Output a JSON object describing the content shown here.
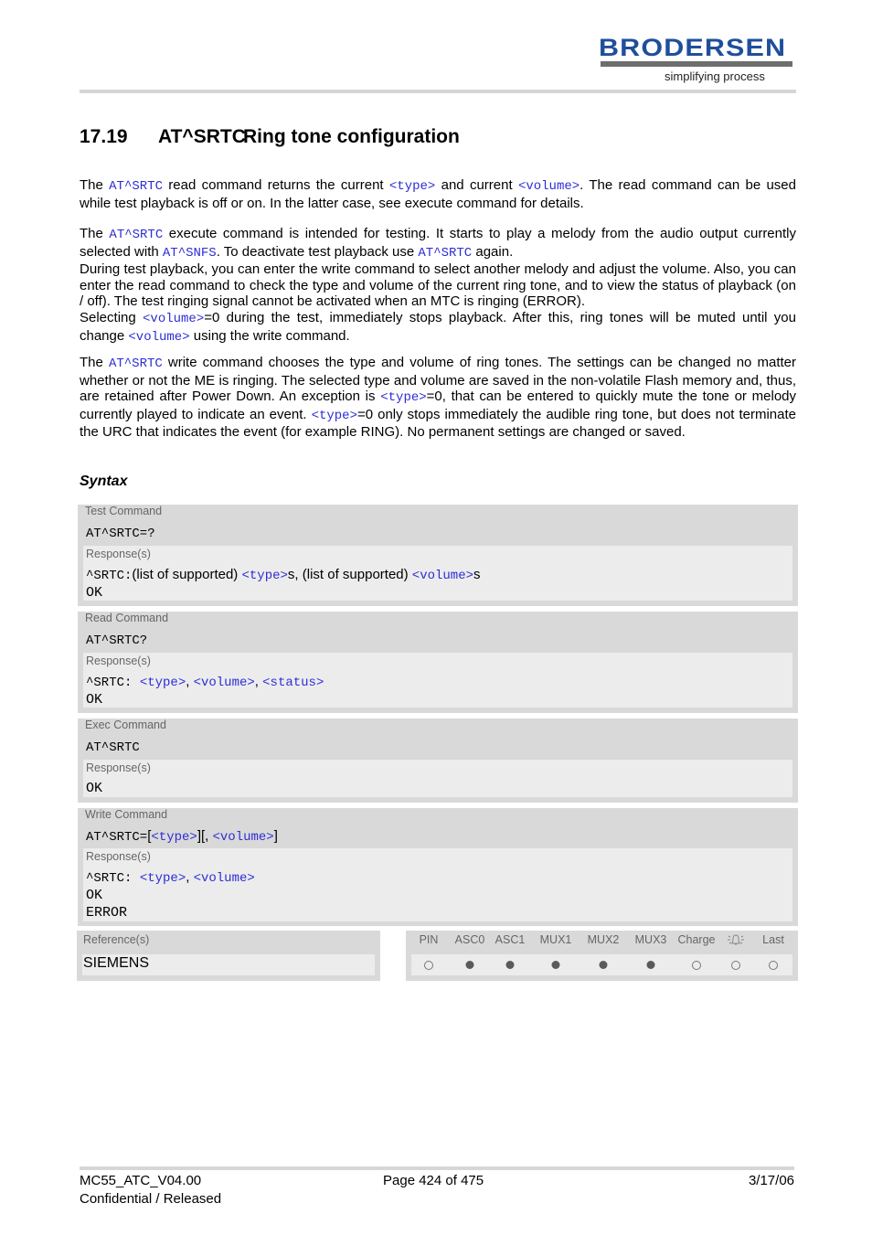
{
  "header": {
    "logo_text": "BRODERSEN",
    "logo_tagline": "simplifying process",
    "brand_color": "#1f4f9c"
  },
  "section": {
    "number": "17.19",
    "command": "AT^SRTC",
    "title": "Ring tone configuration"
  },
  "paragraphs": {
    "p1": {
      "t1": "The ",
      "c1": "AT^SRTC",
      "t2": " read command returns the current ",
      "c2": "<type>",
      "t3": " and current ",
      "c3": "<volume>",
      "t4": ". The read command can be used while test playback is off or on. In the latter case, see execute command for details."
    },
    "p2": {
      "t1": "The ",
      "c1": "AT^SRTC",
      "t2": " execute command is intended for testing. It starts to play a melody from the audio output currently selected with ",
      "c2": "AT^SNFS",
      "t3": ". To deactivate test playback use ",
      "c3": "AT^SRTC",
      "t4": " again."
    },
    "p3": "During test playback, you can enter the write command to select another melody and adjust the volume. Also, you can enter the read command to check the type and volume of the current ring tone, and to view the status of playback (on / off). The test ringing signal cannot be activated when an MTC is ringing (ERROR).",
    "p4": {
      "t1": "Selecting ",
      "c1": "<volume>",
      "t2": "=0 during the test, immediately stops playback. After this, ring tones will be muted until you change ",
      "c2": "<volume>",
      "t3": " using the write command."
    },
    "p5": {
      "t1": "The ",
      "c1": "AT^SRTC",
      "t2": " write command chooses the type and volume of ring tones. The settings can be changed no matter whether or not the ME is ringing. The selected type and volume are saved in the non-volatile Flash memory and, thus, are retained after Power Down. An exception is ",
      "c2": "<type>",
      "t3": "=0, that can be entered to quickly mute the tone or melody currently played to indicate an event. ",
      "c3": "<type>",
      "t4": "=0 only stops immediately the audible ring tone, but does not terminate the URC that indicates the event (for example RING). No permanent settings are changed or saved."
    }
  },
  "syntax": {
    "heading": "Syntax",
    "response_label": "Response(s)",
    "test": {
      "label": "Test Command",
      "command": "AT^SRTC=?",
      "resp_prefix": "^SRTC:",
      "resp_t1": "(list of supported) ",
      "resp_c1": "<type>",
      "resp_t2": "s, (list of supported) ",
      "resp_c2": "<volume>",
      "resp_t3": "s",
      "ok": "OK"
    },
    "read": {
      "label": "Read Command",
      "command": "AT^SRTC?",
      "resp_prefix": "^SRTC: ",
      "resp_c1": "<type>",
      "sep1": ", ",
      "resp_c2": "<volume>",
      "sep2": ", ",
      "resp_c3": "<status>",
      "ok": "OK"
    },
    "exec": {
      "label": "Exec Command",
      "command": "AT^SRTC",
      "ok": "OK"
    },
    "write": {
      "label": "Write Command",
      "cmd_prefix": "AT^SRTC=",
      "b1": "[",
      "c1": "<type>",
      "b2": "][, ",
      "c2": "<volume>",
      "b3": "]",
      "resp_prefix": "^SRTC: ",
      "resp_c1": "<type>",
      "sep1": ", ",
      "resp_c2": "<volume>",
      "ok": "OK",
      "error": "ERROR"
    }
  },
  "reference": {
    "label": "Reference(s)",
    "value": "SIEMENS"
  },
  "flags": {
    "columns": [
      {
        "label": "PIN",
        "enabled": false
      },
      {
        "label": "ASC0",
        "enabled": true
      },
      {
        "label": "ASC1",
        "enabled": true
      },
      {
        "label": "MUX1",
        "enabled": true
      },
      {
        "label": "MUX2",
        "enabled": true
      },
      {
        "label": "MUX3",
        "enabled": true
      },
      {
        "label": "Charge",
        "enabled": false
      },
      {
        "label": "bell-icon",
        "enabled": false
      },
      {
        "label": "Last",
        "enabled": false
      }
    ]
  },
  "footer": {
    "doc_id": "MC55_ATC_V04.00",
    "status": "Confidential / Released",
    "page": "Page 424 of 475",
    "date": "3/17/06"
  }
}
